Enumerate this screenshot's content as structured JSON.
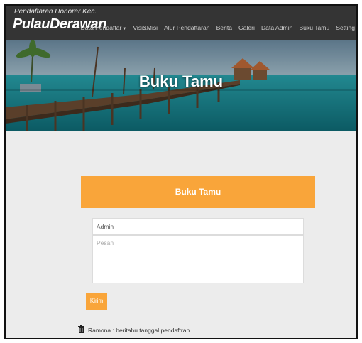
{
  "brand": {
    "small": "Pendaftaran Honorer Kec.",
    "name": "PulauDerawan"
  },
  "nav": [
    {
      "label": "Data Pendaftar"
    },
    {
      "label": "Visi&Misi"
    },
    {
      "label": "Alur Pendaftaran"
    },
    {
      "label": "Berita"
    },
    {
      "label": "Galeri"
    },
    {
      "label": "Data Admin"
    },
    {
      "label": "Buku Tamu"
    },
    {
      "label": "Setting"
    }
  ],
  "hero": {
    "title": "Buku Tamu"
  },
  "panel": {
    "title": "Buku Tamu"
  },
  "form": {
    "name_value": "Admin",
    "message_placeholder": "Pesan",
    "submit_label": "Kirim"
  },
  "comments": [
    {
      "text": "Ramona : beritahu tanggal pendaftran"
    }
  ],
  "colors": {
    "accent": "#f9a53a",
    "navbar": "#343434",
    "background": "#ececec"
  },
  "icons": {
    "dropdown": "caret-down-icon",
    "delete": "trash-icon"
  }
}
